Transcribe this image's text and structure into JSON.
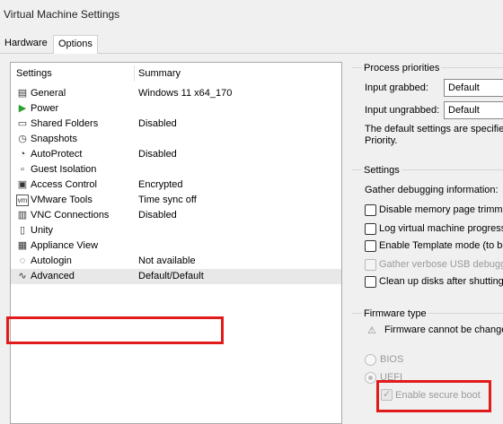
{
  "window": {
    "title": "Virtual Machine Settings"
  },
  "tabs": [
    {
      "label": "Hardware"
    },
    {
      "label": "Options"
    }
  ],
  "settings_list": {
    "headers": {
      "settings": "Settings",
      "summary": "Summary"
    },
    "rows": [
      {
        "name": "General",
        "summary": "Windows 11 x64_170",
        "icon": "general-icon"
      },
      {
        "name": "Power",
        "summary": "",
        "icon": "power-icon"
      },
      {
        "name": "Shared Folders",
        "summary": "Disabled",
        "icon": "shared-folders-icon"
      },
      {
        "name": "Snapshots",
        "summary": "",
        "icon": "snapshots-icon"
      },
      {
        "name": "AutoProtect",
        "summary": "Disabled",
        "icon": "autoprotect-icon"
      },
      {
        "name": "Guest Isolation",
        "summary": "",
        "icon": "guest-isolation-icon"
      },
      {
        "name": "Access Control",
        "summary": "Encrypted",
        "icon": "access-control-icon"
      },
      {
        "name": "VMware Tools",
        "summary": "Time sync off",
        "icon": "vmware-tools-icon"
      },
      {
        "name": "VNC Connections",
        "summary": "Disabled",
        "icon": "vnc-icon"
      },
      {
        "name": "Unity",
        "summary": "",
        "icon": "unity-icon"
      },
      {
        "name": "Appliance View",
        "summary": "",
        "icon": "appliance-view-icon"
      },
      {
        "name": "Autologin",
        "summary": "Not available",
        "icon": "autologin-icon"
      },
      {
        "name": "Advanced",
        "summary": "Default/Default",
        "icon": "advanced-icon"
      }
    ],
    "selected": "Advanced"
  },
  "process_priorities": {
    "title": "Process priorities",
    "input_grabbed_label": "Input grabbed:",
    "input_grabbed_value": "Default",
    "input_ungrabbed_label": "Input ungrabbed:",
    "input_ungrabbed_value": "Default",
    "description_line1": "The default settings are specifie",
    "description_line2": "Priority."
  },
  "settings_group": {
    "title": "Settings",
    "debug_label": "Gather debugging information:",
    "checkboxes": [
      {
        "label": "Disable memory page trimming",
        "checked": false,
        "enabled": true
      },
      {
        "label": "Log virtual machine progress",
        "checked": false,
        "enabled": true
      },
      {
        "label": "Enable Template mode (to be",
        "checked": false,
        "enabled": true
      },
      {
        "label": "Gather verbose USB debugging",
        "checked": false,
        "enabled": false
      },
      {
        "label": "Clean up disks after shutting",
        "checked": false,
        "enabled": true
      }
    ]
  },
  "firmware": {
    "title": "Firmware type",
    "warning": "Firmware cannot be changed",
    "options": [
      {
        "label": "BIOS",
        "selected": false
      },
      {
        "label": "UEFI",
        "selected": true
      }
    ],
    "secure_boot_label": "Enable secure boot",
    "secure_boot_checked": true
  },
  "colors": {
    "highlight": "#e11b1b",
    "panel_bg": "#f0f0f0"
  }
}
